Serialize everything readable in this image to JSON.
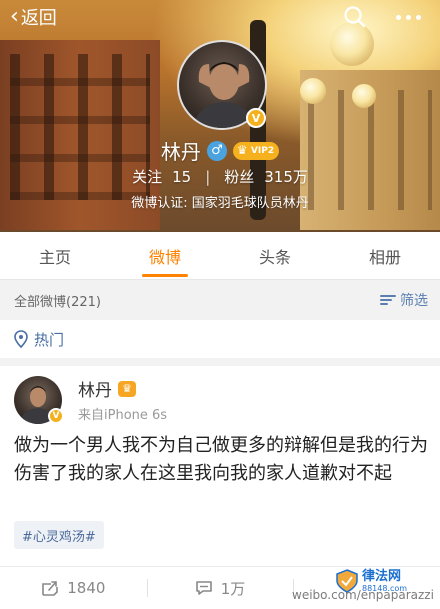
{
  "header": {
    "back_label": "返回",
    "name": "林丹",
    "vip_level": "VIP2",
    "follow_label": "关注",
    "follow_count": "15",
    "fans_label": "粉丝",
    "fans_count": "315万",
    "verification": "微博认证: 国家羽毛球队员林丹"
  },
  "tabs": [
    {
      "label": "主页"
    },
    {
      "label": "微博",
      "active": true
    },
    {
      "label": "头条"
    },
    {
      "label": "相册"
    }
  ],
  "filter": {
    "count_label": "全部微博(221)",
    "filter_label": "筛选"
  },
  "hot": {
    "label": "热门"
  },
  "post": {
    "author": "林丹",
    "source": "来自iPhone 6s",
    "text": "做为一个男人我不为自己做更多的辩解但是我的行为伤害了我的家人在这里我向我的家人道歉对不起",
    "tag": "#心灵鸡汤#"
  },
  "actions": {
    "repost_count": "1840",
    "comment_count": "1万"
  },
  "watermark": {
    "site": "weibo.com/enpaparazzi",
    "logo_main": "律法网",
    "logo_sub": "88148.com"
  },
  "colors": {
    "accent": "#ff8200",
    "link_blue": "#4a6fa5",
    "vip_gold": "#f6b11f"
  },
  "icons": {
    "back": "chevron-left-icon",
    "search": "search-icon",
    "more": "more-dots-icon",
    "gender": "male-icon",
    "filter": "filter-icon",
    "hot": "location-pin-icon",
    "repost": "repost-icon",
    "comment": "comment-icon"
  }
}
